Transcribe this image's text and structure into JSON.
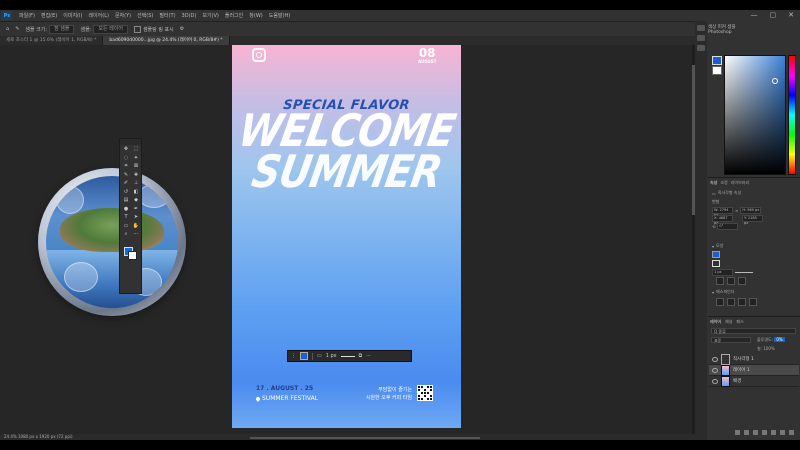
{
  "app": {
    "logo": "Ps",
    "menu": [
      "파일(F)",
      "편집(E)",
      "이미지(I)",
      "레이어(L)",
      "문자(Y)",
      "선택(S)",
      "필터(T)",
      "3D(D)",
      "보기(V)",
      "플러그인",
      "창(W)",
      "도움말(H)"
    ],
    "window_controls": [
      "—",
      "▢",
      "✕"
    ]
  },
  "options_bar": {
    "sample_label": "샘플 크기:",
    "sample_value": "점 샘플",
    "sample2_label": "샘플:",
    "sample2_value": "모든 레이어",
    "ring_label": "샘플링 링 표시"
  },
  "tabs": [
    {
      "label": "세로 포스터 1 @ 15.6% (레이어 1, RGB/8) *",
      "active": false
    },
    {
      "label": "bad6090d0000...jpg @ 24.4% (레이어 0, RGB/8#) *",
      "active": true
    }
  ],
  "status": {
    "text": "24.4%   1080 px x 1920 px (72 ppi)"
  },
  "poster": {
    "date_big": "08",
    "date_small": "AUGUST",
    "special": "SPECIAL FLAVOR",
    "welcome": "WELCOME",
    "summer": "SUMMER",
    "date_range": "17 . AUGUST . 25",
    "festival": "SUMMER FESTIVAL",
    "korean_line1": "부담없이 즐기는",
    "korean_line2": "시원한 오후 커피 타임"
  },
  "context_bar": {
    "stroke_value": "1 px"
  },
  "panels": {
    "color_title": "색상 피커 샘플",
    "color_sub": "Photoshop",
    "properties_tabs": [
      "속성",
      "조정",
      "라이브러리"
    ],
    "shape_label": "직사각형 속성",
    "transform_label": "변형",
    "w": "W: 2794 px",
    "h": "H: 960 px",
    "x": "X: 4687 px",
    "y": "Y: 2185 px",
    "rotation": "0°",
    "appearance_label": "모양",
    "stroke_px": "1 px",
    "pathfinder_label": "패스파인더",
    "layers_tabs": [
      "레이어",
      "채널",
      "패스"
    ],
    "filter_text": "Q 종류",
    "blend_mode": "표준",
    "opacity_label": "불투명도:",
    "opacity_value": "0%",
    "fill_label": "칠:",
    "fill_value": "100%",
    "layers": [
      {
        "name": "직사각형 1",
        "selected": false
      },
      {
        "name": "레이어 1",
        "selected": true
      },
      {
        "name": "배경",
        "selected": false
      }
    ]
  },
  "colors": {
    "accent": "#1a5fd0",
    "panel": "#323232",
    "canvas": "#262626"
  }
}
